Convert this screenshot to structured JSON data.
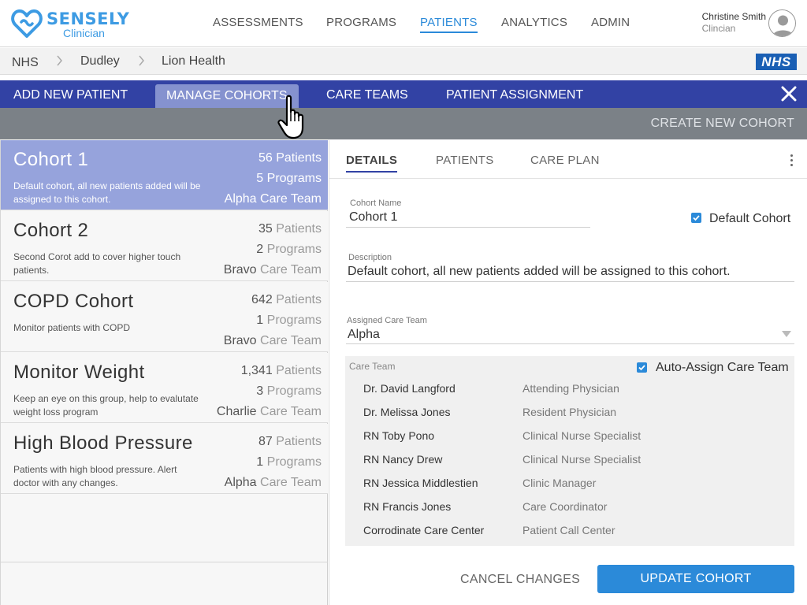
{
  "brand": {
    "name": "SENSELY",
    "subtitle": "Clinician"
  },
  "nav": [
    {
      "label": "ASSESSMENTS",
      "active": false
    },
    {
      "label": "PROGRAMS",
      "active": false
    },
    {
      "label": "PATIENTS",
      "active": true
    },
    {
      "label": "ANALYTICS",
      "active": false
    },
    {
      "label": "ADMIN",
      "active": false
    }
  ],
  "user": {
    "name": "Christine Smith",
    "role": "Clincian",
    "icon": "avatar-icon"
  },
  "breadcrumb": [
    "NHS",
    "Dudley",
    "Lion Health"
  ],
  "nhs_logo": "NHS",
  "tabs": [
    {
      "label": "ADD NEW PATIENT",
      "active": false
    },
    {
      "label": "MANAGE COHORTS",
      "active": true
    },
    {
      "label": "CARE TEAMS",
      "active": false
    },
    {
      "label": "PATIENT ASSIGNMENT",
      "active": false
    }
  ],
  "toolbar": {
    "create_label": "CREATE NEW COHORT"
  },
  "cohorts": [
    {
      "name": "Cohort 1",
      "description": "Default cohort, all new patients added will be assigned to this cohort.",
      "patients_count": "56",
      "patients_label": "Patients",
      "programs_count": "5",
      "programs_label": "Programs",
      "team_name": "Alpha",
      "team_label": "Care Team",
      "selected": true
    },
    {
      "name": "Cohort 2",
      "description": "Second Corot add to cover higher touch patients.",
      "patients_count": "35",
      "patients_label": "Patients",
      "programs_count": "2",
      "programs_label": "Programs",
      "team_name": "Bravo",
      "team_label": "Care Team",
      "selected": false
    },
    {
      "name": "COPD Cohort",
      "description": "Monitor patients with COPD",
      "patients_count": "642",
      "patients_label": "Patients",
      "programs_count": "1",
      "programs_label": "Programs",
      "team_name": "Bravo",
      "team_label": "Care Team",
      "selected": false
    },
    {
      "name": "Monitor Weight",
      "description": "Keep an eye on this group, help to evalutate weight loss program",
      "patients_count": "1,341",
      "patients_label": "Patients",
      "programs_count": "3",
      "programs_label": "Programs",
      "team_name": "Charlie",
      "team_label": "Care Team",
      "selected": false
    },
    {
      "name": "High Blood Pressure",
      "description": "Patients with high blood pressure.  Alert doctor with any changes.",
      "patients_count": "87",
      "patients_label": "Patients",
      "programs_count": "1",
      "programs_label": "Programs",
      "team_name": "Alpha",
      "team_label": "Care Team",
      "selected": false
    }
  ],
  "detail": {
    "tabs": [
      {
        "label": "DETAILS",
        "active": true
      },
      {
        "label": "PATIENTS",
        "active": false
      },
      {
        "label": "CARE PLAN",
        "active": false
      }
    ],
    "cohort_name_label": "Cohort Name",
    "cohort_name_value": "Cohort 1",
    "default_cohort_label": "Default Cohort",
    "default_cohort_checked": true,
    "description_label": "Description",
    "description_value": "Default cohort, all new patients added will be assigned to this cohort.",
    "assigned_team_label": "Assigned Care Team",
    "assigned_team_value": "Alpha",
    "care_team_label": "Care Team",
    "auto_assign_label": "Auto-Assign Care Team",
    "auto_assign_checked": true,
    "members": [
      {
        "name": "Dr. David Langford",
        "role": "Attending Physician"
      },
      {
        "name": "Dr. Melissa Jones",
        "role": "Resident Physician"
      },
      {
        "name": "RN Toby Pono",
        "role": "Clinical Nurse Specialist"
      },
      {
        "name": "RN Nancy Drew",
        "role": "Clinical Nurse Specialist"
      },
      {
        "name": "RN Jessica Middlestien",
        "role": "Clinic Manager"
      },
      {
        "name": "RN Francis Jones",
        "role": "Care Coordinator"
      },
      {
        "name": "Corrodinate Care Center",
        "role": "Patient Call Center"
      }
    ],
    "cancel_label": "CANCEL CHANGES",
    "update_label": "UPDATE COHORT"
  },
  "colors": {
    "brand_blue": "#3d9be3",
    "tabbar": "#3242a4",
    "tab_active": "#8592cf",
    "selected_row": "#96a3dc",
    "toolbar": "#7b8187",
    "primary_button": "#2b8ad9"
  }
}
